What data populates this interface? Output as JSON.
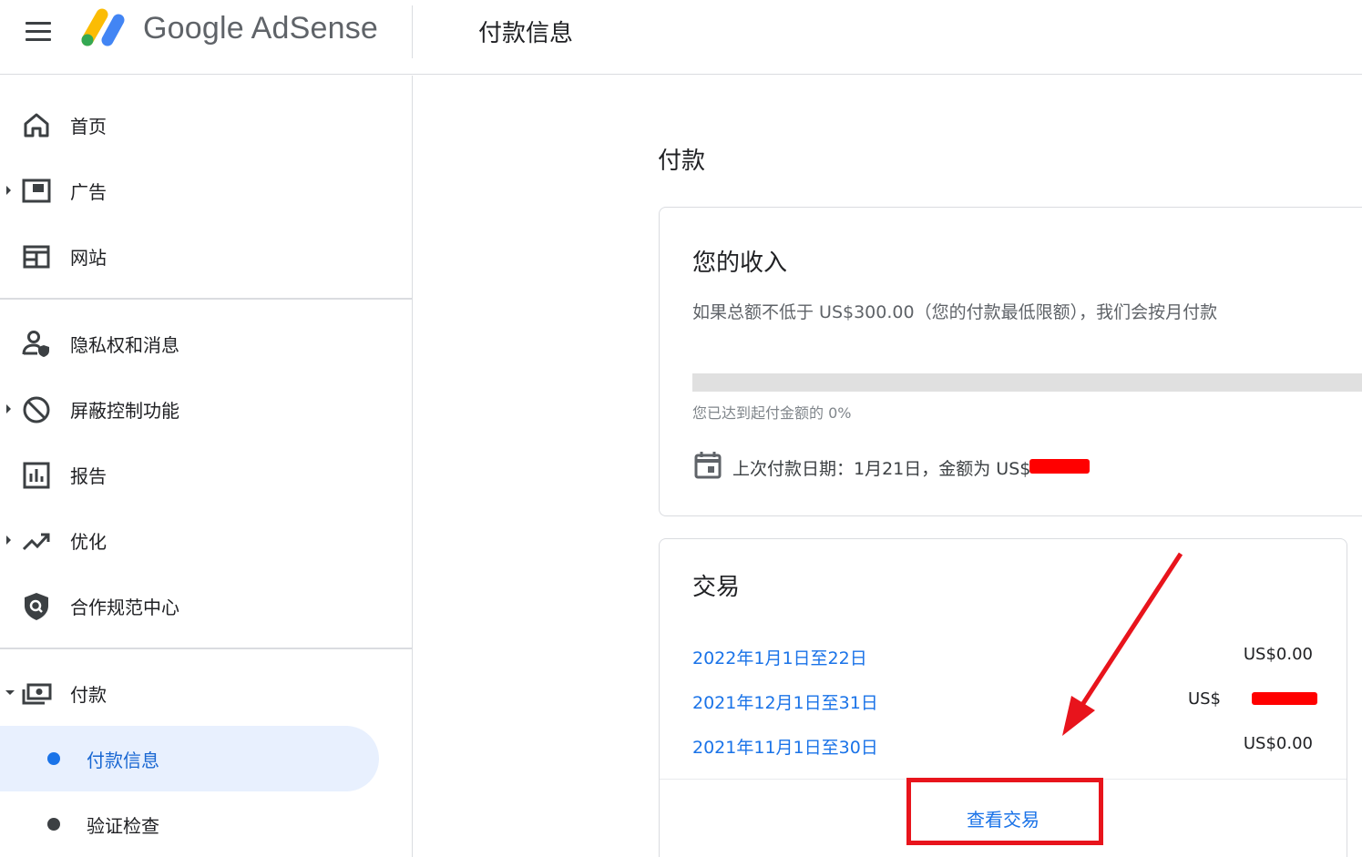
{
  "header": {
    "brand": "Google AdSense",
    "page_title": "付款信息"
  },
  "sidebar": {
    "items": [
      {
        "label": "首页",
        "icon": "home-icon"
      },
      {
        "label": "广告",
        "icon": "ads-icon"
      },
      {
        "label": "网站",
        "icon": "sites-icon"
      },
      {
        "label": "隐私权和消息",
        "icon": "privacy-icon"
      },
      {
        "label": "屏蔽控制功能",
        "icon": "block-icon"
      },
      {
        "label": "报告",
        "icon": "reports-icon"
      },
      {
        "label": "优化",
        "icon": "trending-up-icon"
      },
      {
        "label": "合作规范中心",
        "icon": "policy-shield-icon"
      },
      {
        "label": "付款",
        "icon": "payments-icon"
      }
    ],
    "sub_items": [
      {
        "label": "付款信息",
        "active": true
      },
      {
        "label": "验证检查",
        "active": false
      }
    ]
  },
  "main": {
    "section_heading": "付款",
    "income": {
      "title": "您的收入",
      "description": "如果总额不低于 US$300.00（您的付款最低限额），我们会按月付款",
      "progress_percent": 0,
      "progress_text": "您已达到起付金额的 0%",
      "last_payment": "上次付款日期：1月21日，金额为 US$"
    },
    "transactions": {
      "title": "交易",
      "rows": [
        {
          "date": "2022年1月1日至22日",
          "amount": "US$0.00"
        },
        {
          "date": "2021年12月1日至31日",
          "amount": "US$"
        },
        {
          "date": "2021年11月1日至30日",
          "amount": "US$0.00"
        }
      ],
      "view_label": "查看交易"
    }
  },
  "colors": {
    "link": "#1a73e8",
    "active_bg": "#e8f0fe",
    "annotation_red": "#e8141c"
  }
}
